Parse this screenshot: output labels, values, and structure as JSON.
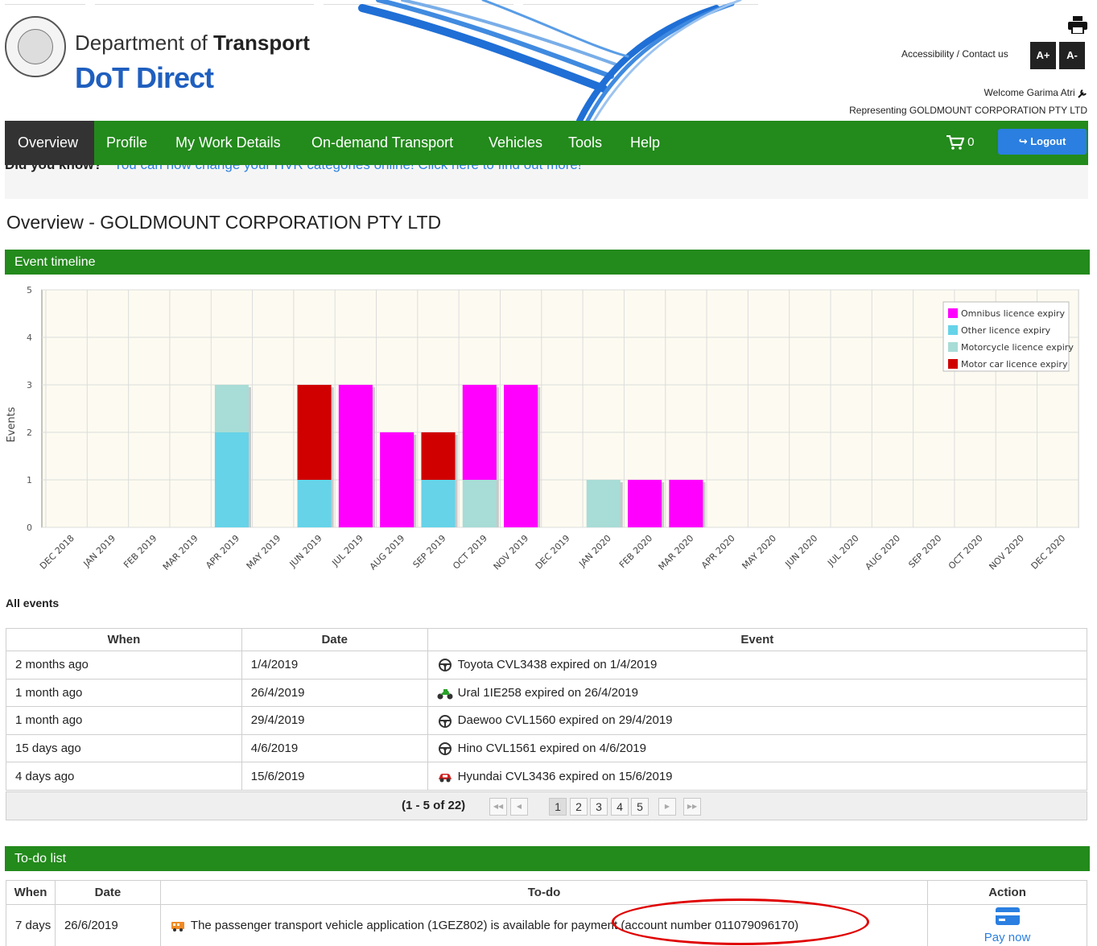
{
  "header": {
    "dept_prefix": "Department of ",
    "dept_bold": "Transport",
    "brand": "DoT Direct",
    "accessibility": "Accessibility / Contact us",
    "font_increase": "A+",
    "font_decrease": "A-",
    "welcome": "Welcome Garima Atri",
    "representing": "Representing GOLDMOUNT CORPORATION PTY LTD"
  },
  "nav": {
    "items": [
      "Overview",
      "Profile",
      "My Work Details",
      "On-demand Transport",
      "Vehicles",
      "Tools",
      "Help"
    ],
    "active": "Overview",
    "cart_count": "0",
    "logout": "Logout"
  },
  "banner": {
    "bold": "Did you know?",
    "text": "You can now change your HVR categories online! Click here to find out more!"
  },
  "page_title": "Overview - GOLDMOUNT CORPORATION PTY LTD",
  "timeline": {
    "section_title": "Event timeline"
  },
  "chart_data": {
    "type": "bar",
    "stacked": true,
    "ylabel": "Events",
    "ylim": [
      0,
      5
    ],
    "yticks": [
      0,
      1,
      2,
      3,
      4,
      5
    ],
    "grid": true,
    "legend_position": "top-right",
    "categories": [
      "DEC 2018",
      "JAN 2019",
      "FEB 2019",
      "MAR 2019",
      "APR 2019",
      "MAY 2019",
      "JUN 2019",
      "JUL 2019",
      "AUG 2019",
      "SEP 2019",
      "OCT 2019",
      "NOV 2019",
      "DEC 2019",
      "JAN 2020",
      "FEB 2020",
      "MAR 2020",
      "APR 2020",
      "MAY 2020",
      "JUN 2020",
      "JUL 2020",
      "AUG 2020",
      "SEP 2020",
      "OCT 2020",
      "NOV 2020",
      "DEC 2020"
    ],
    "series": [
      {
        "name": "Other licence expiry",
        "color": "#66d3e8",
        "values": [
          0,
          0,
          0,
          0,
          2,
          0,
          1,
          0,
          0,
          1,
          0,
          0,
          0,
          0,
          0,
          0,
          0,
          0,
          0,
          0,
          0,
          0,
          0,
          0,
          0
        ]
      },
      {
        "name": "Motorcycle licence expiry",
        "color": "#a8dcd6",
        "values": [
          0,
          0,
          0,
          0,
          1,
          0,
          0,
          0,
          0,
          0,
          1,
          0,
          0,
          1,
          0,
          0,
          0,
          0,
          0,
          0,
          0,
          0,
          0,
          0,
          0
        ]
      },
      {
        "name": "Motor car licence expiry",
        "color": "#d00000",
        "values": [
          0,
          0,
          0,
          0,
          0,
          0,
          2,
          0,
          0,
          1,
          0,
          0,
          0,
          0,
          0,
          0,
          0,
          0,
          0,
          0,
          0,
          0,
          0,
          0,
          0
        ]
      },
      {
        "name": "Omnibus licence expiry",
        "color": "#ff00ff",
        "values": [
          0,
          0,
          0,
          0,
          0,
          0,
          0,
          3,
          2,
          0,
          2,
          3,
          0,
          0,
          1,
          1,
          0,
          0,
          0,
          0,
          0,
          0,
          0,
          0,
          0
        ]
      }
    ],
    "legend_order": [
      "Omnibus licence expiry",
      "Other licence expiry",
      "Motorcycle licence expiry",
      "Motor car licence expiry"
    ]
  },
  "events": {
    "label": "All events",
    "headers": [
      "When",
      "Date",
      "Event"
    ],
    "rows": [
      {
        "when": "2 months ago",
        "date": "1/4/2019",
        "event": "Toyota CVL3438 expired on 1/4/2019",
        "icon": "steering-wheel-icon"
      },
      {
        "when": "1 month ago",
        "date": "26/4/2019",
        "event": "Ural 1IE258 expired on 26/4/2019",
        "icon": "motorcycle-icon"
      },
      {
        "when": "1 month ago",
        "date": "29/4/2019",
        "event": "Daewoo CVL1560 expired on 29/4/2019",
        "icon": "steering-wheel-icon"
      },
      {
        "when": "15 days ago",
        "date": "4/6/2019",
        "event": "Hino CVL1561 expired on 4/6/2019",
        "icon": "steering-wheel-icon"
      },
      {
        "when": "4 days ago",
        "date": "15/6/2019",
        "event": "Hyundai CVL3436 expired on 15/6/2019",
        "icon": "car-icon"
      }
    ],
    "pager": {
      "info": "(1 - 5 of 22)",
      "pages": [
        "1",
        "2",
        "3",
        "4",
        "5"
      ],
      "current": "1"
    }
  },
  "todo": {
    "section_title": "To-do list",
    "headers": [
      "When",
      "Date",
      "To-do",
      "Action"
    ],
    "rows": [
      {
        "when": "7 days",
        "date": "26/6/2019",
        "todo": "The passenger transport vehicle application (1GEZ802) is available for payment (account number 011079096170)",
        "action": "Pay now"
      }
    ]
  }
}
